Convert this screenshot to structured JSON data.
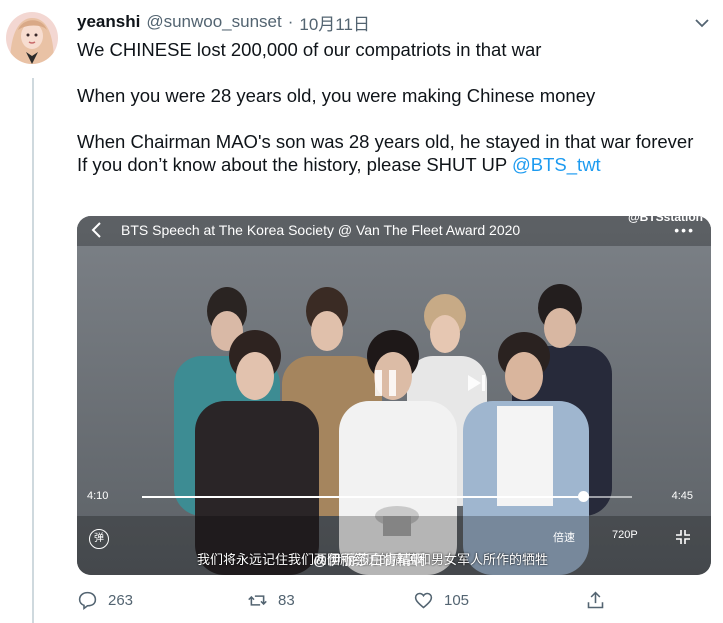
{
  "tweet": {
    "display_name": "yeanshi",
    "handle": "@sunwoo_sunset",
    "separator": "·",
    "date": "10月11日",
    "lines": [
      "We CHINESE lost 200,000 of our compatriots in that war",
      "When you were 28 years old, you were making Chinese money",
      "When Chairman MAO's son was 28 years old, he stayed in that war forever",
      "If you don’t know about the history, please SHUT UP "
    ],
    "mention": "@BTS_twt"
  },
  "video": {
    "title": "BTS Speech at The Korea Society @ Van The Fleet Award 2020",
    "watermark": "@BTSstation",
    "menu": "•••",
    "current_time": "4:10",
    "duration": "4:45",
    "progress": 0.9,
    "subtitle": "我们将永远记住我们两国所经历的痛苦和男女军人所作的牺牲",
    "weibo_watermark": "@伊丽莎白肯精啊",
    "danmu_label": "弹",
    "speed_label": "倍速",
    "quality_label": "720P"
  },
  "actions": {
    "replies": "263",
    "retweets": "83",
    "likes": "105"
  },
  "colors": {
    "accent": "#1d9bf0",
    "muted": "#536471",
    "text": "#0f1419"
  }
}
